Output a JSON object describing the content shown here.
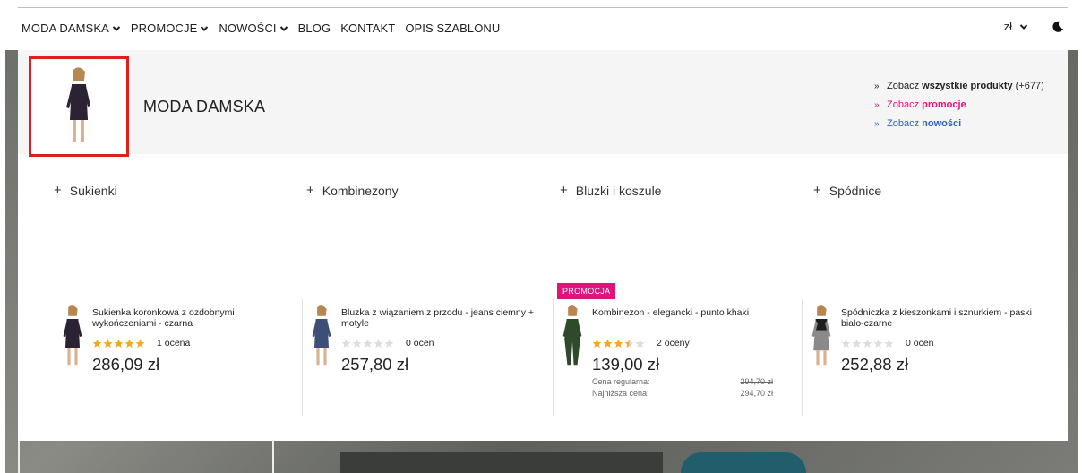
{
  "nav": {
    "items": [
      {
        "label": "MODA DAMSKA",
        "dropdown": true
      },
      {
        "label": "PROMOCJE",
        "dropdown": true
      },
      {
        "label": "NOWOŚCI",
        "dropdown": true
      },
      {
        "label": "BLOG",
        "dropdown": false
      },
      {
        "label": "KONTAKT",
        "dropdown": false
      },
      {
        "label": "OPIS SZABLONU",
        "dropdown": false
      }
    ],
    "currency": "zł",
    "theme_icon": "moon-icon"
  },
  "menu": {
    "category_title": "MODA DAMSKA",
    "see_links": [
      {
        "prefix": "Zobacz ",
        "bold": "wszystkie produkty",
        "suffix": " (+677)",
        "color": "#222222"
      },
      {
        "prefix": "Zobacz ",
        "bold": "promocje",
        "suffix": "",
        "color": "#e0127b"
      },
      {
        "prefix": "Zobacz ",
        "bold": "nowości",
        "suffix": "",
        "color": "#2f5ec4"
      }
    ],
    "subcategories": [
      "Sukienki",
      "Kombinezony",
      "Bluzki i koszule",
      "Spódnice"
    ],
    "products": [
      {
        "name": "Sukienka koronkowa z ozdobnymi wykończeniami - czarna",
        "rating": 5,
        "rating_text": "1 ocena",
        "price": "286,09 zł",
        "badge": "",
        "regular_label": "",
        "regular_price": "",
        "lowest_label": "",
        "lowest_price": "",
        "garment_color": "#2b2233"
      },
      {
        "name": "Bluzka z wiązaniem z przodu - jeans ciemny + motyle",
        "rating": 0,
        "rating_text": "0 ocen",
        "price": "257,80 zł",
        "badge": "",
        "regular_label": "",
        "regular_price": "",
        "lowest_label": "",
        "lowest_price": "",
        "garment_color": "#3e4f77"
      },
      {
        "name": "Kombinezon - elegancki - punto khaki",
        "rating": 3.5,
        "rating_text": "2 oceny",
        "price": "139,00 zł",
        "badge": "PROMOCJA",
        "regular_label": "Cena regularna:",
        "regular_price": "294,70 zł",
        "lowest_label": "Najniższa cena:",
        "lowest_price": "294,70 zł",
        "garment_color": "#2f4a2a"
      },
      {
        "name": "Spódniczka z kieszonkami i sznurkiem - paski biało-czarne",
        "rating": 0,
        "rating_text": "0 ocen",
        "price": "252,88 zł",
        "badge": "",
        "regular_label": "",
        "regular_price": "",
        "lowest_label": "",
        "lowest_price": "",
        "garment_color": "#8a8a8a"
      }
    ]
  },
  "colors": {
    "accent_pink": "#e0127b",
    "link_blue": "#2f5ec4",
    "star_gold": "#f5a623",
    "star_empty": "#dddddd",
    "highlight_red": "#e01e1e"
  }
}
